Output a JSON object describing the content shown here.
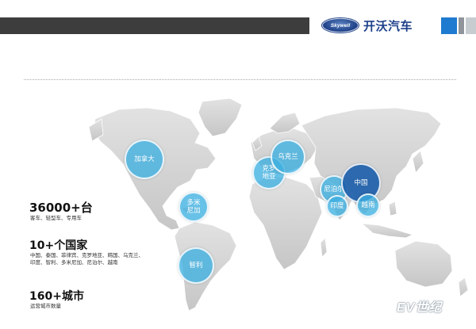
{
  "header": {
    "logo_text": "Skywell",
    "brand_cn": "开沃汽车"
  },
  "bubbles": [
    {
      "label": "加拿大"
    },
    {
      "label": "克罗\n地亚"
    },
    {
      "label": "乌克兰"
    },
    {
      "label": "尼泊尔"
    },
    {
      "label": "中国"
    },
    {
      "label": "印度"
    },
    {
      "label": "越南"
    },
    {
      "label": "多米\n尼加"
    },
    {
      "label": "智利"
    }
  ],
  "stats": [
    {
      "value": "36000+台",
      "desc": "客车、轻型车、专用车"
    },
    {
      "value": "10+个国家",
      "desc": "中国、泰国、菲律宾、克罗地亚、韩国、乌克兰、\n印度、智利、多米尼加、尼泊尔、越南"
    },
    {
      "value": "160+城市",
      "desc": "运营城市数量"
    }
  ],
  "watermark": "EV世纪",
  "colors": {
    "header_bar": "#3d3d3d",
    "accent_blue": "#1e7bd0",
    "bubble": "#3eafe0",
    "china_bubble": "#1e5faa",
    "land": "#d4d4d4"
  }
}
